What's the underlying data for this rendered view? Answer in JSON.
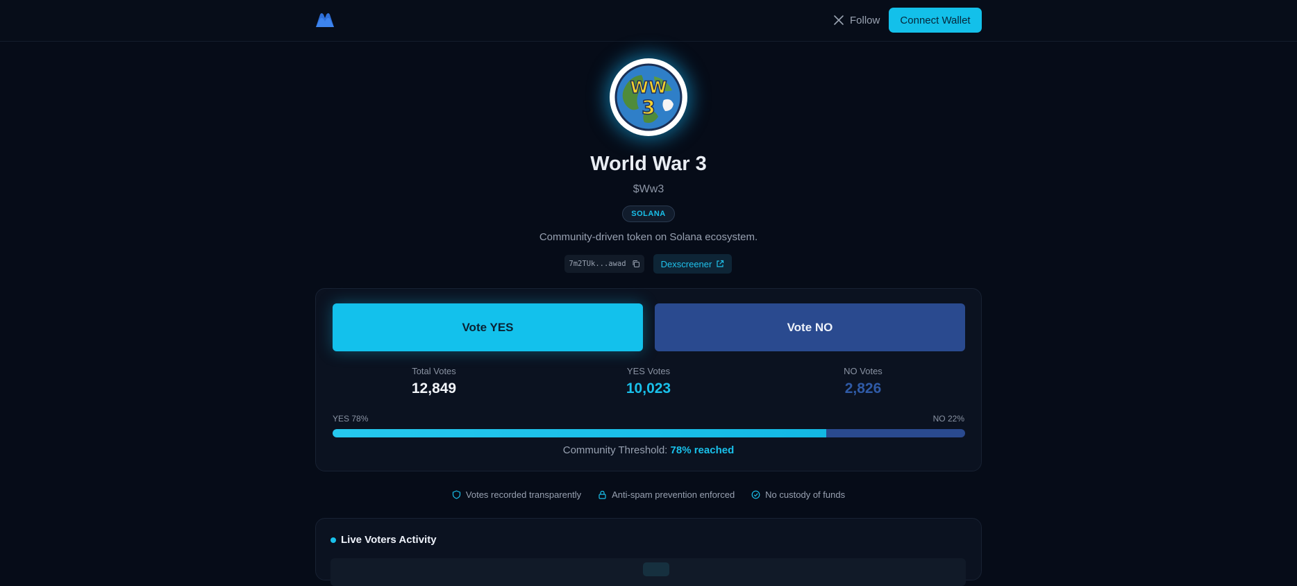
{
  "header": {
    "logo_icon": "brand-m-logo",
    "follow_label": "Follow",
    "follow_icon": "x-twitter-icon",
    "connect_label": "Connect Wallet"
  },
  "token": {
    "avatar_icon": "ww3-globe-logo",
    "name": "World War 3",
    "ticker": "$Ww3",
    "chain": "SOLANA",
    "description": "Community-driven token on Solana ecosystem.",
    "address_short": "7m2TUk...awad",
    "dex_label": "Dexscreener"
  },
  "vote": {
    "yes_label": "Vote YES",
    "no_label": "Vote NO",
    "total_label": "Total Votes",
    "total_value": "12,849",
    "yes_votes_label": "YES Votes",
    "yes_votes_value": "10,023",
    "no_votes_label": "NO Votes",
    "no_votes_value": "2,826",
    "yes_pct_label": "YES 78%",
    "no_pct_label": "NO 22%",
    "yes_fraction": 0.78,
    "threshold_label": "Community Threshold:",
    "threshold_value": "78% reached"
  },
  "trust": {
    "item1": "Votes recorded transparently",
    "item2": "Anti-spam prevention enforced",
    "item3": "No custody of funds"
  },
  "live": {
    "title": "Live Voters Activity"
  },
  "colors": {
    "accent": "#13c1ec",
    "no_blue": "#2a4a8f",
    "background": "#060c18"
  }
}
